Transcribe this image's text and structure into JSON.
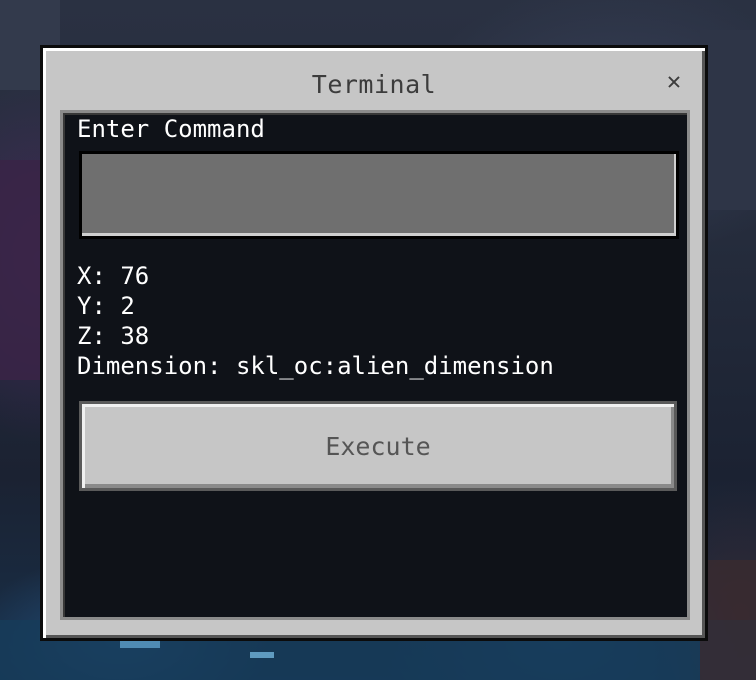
{
  "window": {
    "title": "Terminal",
    "close_glyph": "✕"
  },
  "command": {
    "label": "Enter Command",
    "value": "",
    "placeholder": ""
  },
  "coordinates": {
    "x": "X: 76",
    "y": "Y: 2",
    "z": "Z: 38",
    "dimension": "Dimension: skl_oc:alien_dimension"
  },
  "actions": {
    "execute_label": "Execute"
  },
  "colors": {
    "dialog_bg": "#c6c6c6",
    "panel_bg": "#0f1218",
    "input_bg": "#6f6f6f",
    "text_light": "#ffffff",
    "text_dark": "#3c3c3c"
  },
  "icons": {
    "close": "close-icon"
  }
}
